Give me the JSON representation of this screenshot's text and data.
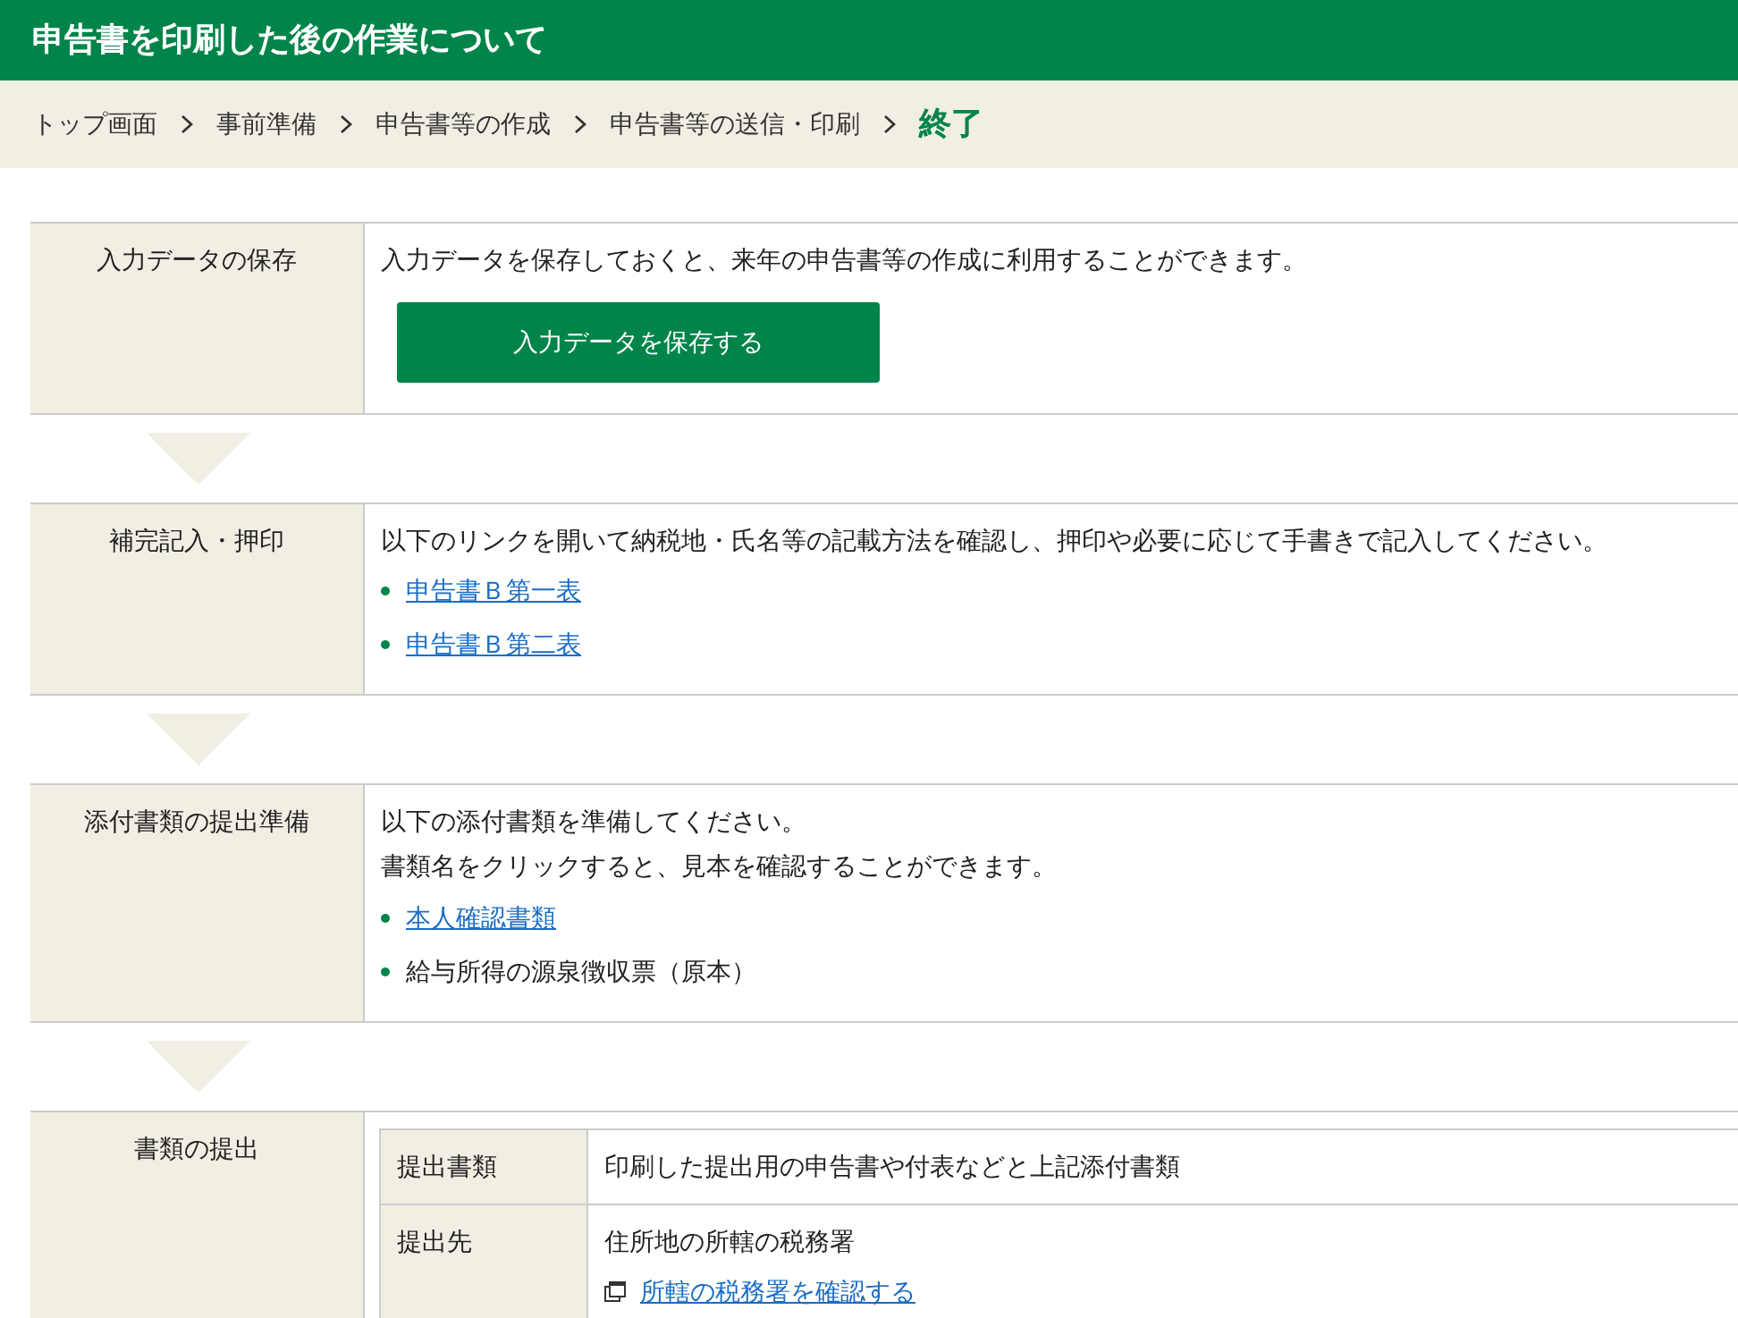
{
  "header": {
    "title": "申告書を印刷した後の作業について"
  },
  "breadcrumb": [
    {
      "label": "トップ画面",
      "selected": false
    },
    {
      "label": "事前準備",
      "selected": false
    },
    {
      "label": "申告書等の作成",
      "selected": false
    },
    {
      "label": "申告書等の送信・印刷",
      "selected": false
    },
    {
      "label": "終了",
      "selected": true
    }
  ],
  "steps": [
    {
      "label": "入力データの保存",
      "paragraphs": [
        "入力データを保存しておくと、来年の申告書等の作成に利用することができます。"
      ],
      "button": "入力データを保存する"
    },
    {
      "label": "補完記入・押印",
      "paragraphs": [
        "以下のリンクを開いて納税地・氏名等の記載方法を確認し、押印や必要に応じて手書きで記入してください。"
      ],
      "items": [
        {
          "kind": "link",
          "text": "申告書Ｂ第一表"
        },
        {
          "kind": "link",
          "text": "申告書Ｂ第二表"
        }
      ]
    },
    {
      "label": "添付書類の提出準備",
      "paragraphs": [
        "以下の添付書類を準備してください。",
        "書類名をクリックすると、見本を確認することができます。"
      ],
      "items": [
        {
          "kind": "link",
          "text": "本人確認書類"
        },
        {
          "kind": "text",
          "text": "給与所得の源泉徴収票（原本）"
        }
      ]
    },
    {
      "label": "書類の提出",
      "table": [
        {
          "header": "提出書類",
          "lines": [
            {
              "kind": "text",
              "text": "印刷した提出用の申告書や付表などと上記添付書類"
            }
          ]
        },
        {
          "header": "提出先",
          "lines": [
            {
              "kind": "text",
              "text": "住所地の所轄の税務署"
            },
            {
              "kind": "external_link",
              "text": "所轄の税務署を確認する"
            }
          ]
        }
      ]
    }
  ]
}
